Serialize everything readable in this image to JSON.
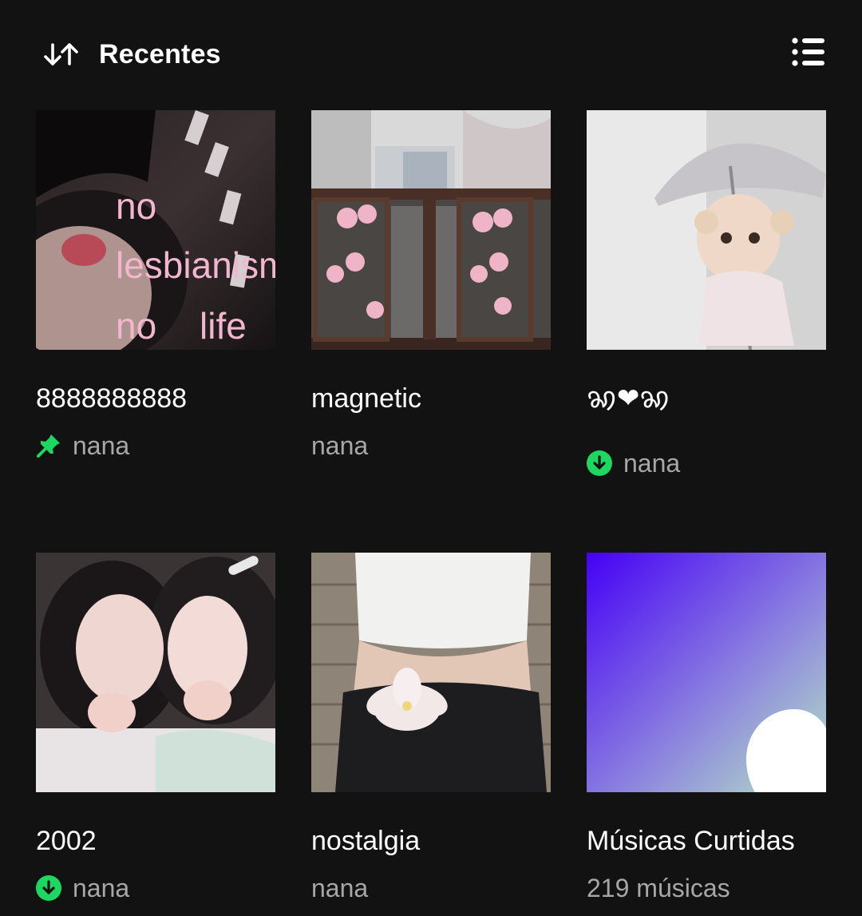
{
  "header": {
    "sort_label": "Recentes",
    "sort_icon": "sort-arrows-icon",
    "view_icon": "list-view-icon"
  },
  "colors": {
    "background": "#121212",
    "accent_green": "#1ed760",
    "text_primary": "#ffffff",
    "text_secondary": "#a7a7a7",
    "liked_gradient_start": "#4500f5",
    "liked_gradient_end": "#b4e6c4"
  },
  "library": [
    {
      "title": "8888888888",
      "subtitle": "nana",
      "status_icon": "pin-icon"
    },
    {
      "title": "magnetic",
      "subtitle": "nana",
      "status_icon": ""
    },
    {
      "title": "ꩆ❤ꩆ",
      "subtitle": "nana",
      "status_icon": "download-icon"
    },
    {
      "title": "2002",
      "subtitle": "nana",
      "status_icon": "download-icon"
    },
    {
      "title": "nostalgia",
      "subtitle": "nana",
      "status_icon": ""
    },
    {
      "title": "Músicas Curtidas",
      "subtitle": "219 músicas",
      "status_icon": ""
    }
  ],
  "cover1_text": [
    "no",
    "lesbianism",
    "no",
    "life"
  ]
}
